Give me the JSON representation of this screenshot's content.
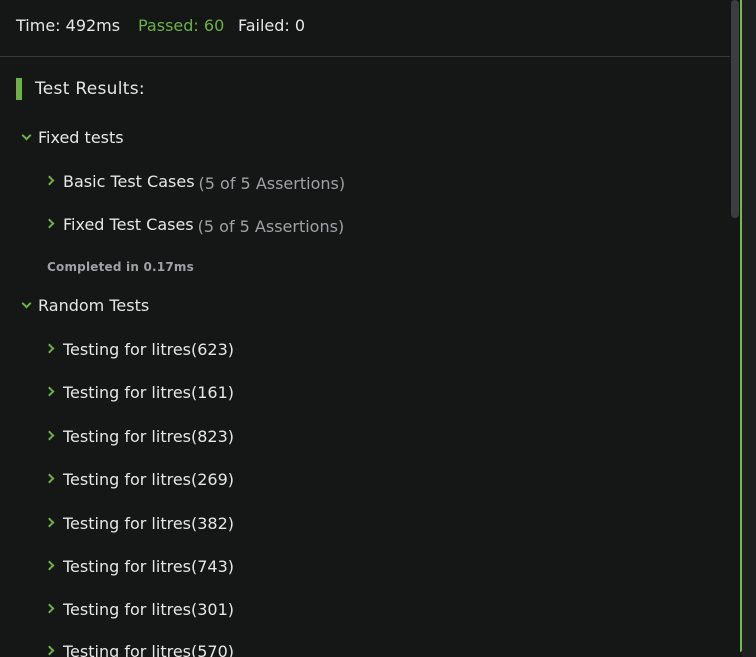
{
  "status": {
    "time": "Time: 492ms",
    "passed": "Passed: 60",
    "failed": "Failed: 0"
  },
  "results": {
    "title": "Test Results:"
  },
  "fixed_group": {
    "label": "Fixed tests",
    "tests": [
      {
        "label": "Basic Test Cases",
        "count": "(5 of 5 Assertions)"
      },
      {
        "label": "Fixed Test Cases",
        "count": "(5 of 5 Assertions)"
      }
    ],
    "completed": "Completed in 0.17ms"
  },
  "random_group": {
    "label": "Random Tests",
    "tests": [
      {
        "label": "Testing for litres(623)"
      },
      {
        "label": "Testing for litres(161)"
      },
      {
        "label": "Testing for litres(823)"
      },
      {
        "label": "Testing for litres(269)"
      },
      {
        "label": "Testing for litres(382)"
      },
      {
        "label": "Testing for litres(743)"
      },
      {
        "label": "Testing for litres(301)"
      },
      {
        "label": "Testing for litres(570)"
      }
    ]
  },
  "colors": {
    "background": "#151717",
    "passed": "#6cb046",
    "accent_border": "#6fbe4a",
    "muted_text": "#9ea2a4",
    "text": "#e6e6e6"
  },
  "icons": {
    "expanded": "chevron-down-icon",
    "collapsed": "chevron-right-icon"
  }
}
